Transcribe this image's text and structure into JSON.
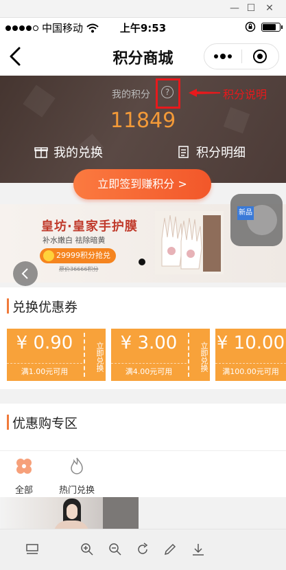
{
  "window": {
    "minimize_icon": "minimize-icon",
    "maximize_icon": "maximize-icon",
    "close_icon": "close-icon"
  },
  "status_bar": {
    "carrier": "中国移动",
    "time": "上午9:53",
    "signal_dots": 5
  },
  "nav": {
    "title": "积分商城"
  },
  "points": {
    "label": "我的积分",
    "value": "11849",
    "annotation": "积分说明",
    "menu": [
      {
        "label": "我的兑换",
        "icon": "gift-icon"
      },
      {
        "label": "积分明细",
        "icon": "receipt-icon"
      }
    ]
  },
  "checkin": {
    "label": "立即签到赚积分 >"
  },
  "banner": {
    "title": "皇坊·皇家手护膜",
    "subtitle": "补水嫩白 祛除暗黄",
    "price": "29999积分抢兑",
    "old_price": "原价36666积分",
    "float_tag": "新品"
  },
  "coupon_section": {
    "title": "兑换优惠券",
    "coupons": [
      {
        "amount": "¥ 0.90",
        "condition": "满1.00元可用",
        "action": "立即兑换"
      },
      {
        "amount": "¥ 3.00",
        "condition": "满4.00元可用",
        "action": "立即兑换"
      },
      {
        "amount": "¥ 10.00",
        "condition": "满100.00元可用",
        "action": ""
      }
    ]
  },
  "deal_section": {
    "title": "优惠购专区"
  },
  "categories": [
    {
      "label": "全部",
      "icon": "clover-icon"
    },
    {
      "label": "热门兑换",
      "icon": "flame-icon"
    }
  ],
  "toolbar": {
    "icons": [
      "layout-icon",
      "zoom-in-icon",
      "zoom-out-icon",
      "rotate-icon",
      "edit-icon",
      "download-icon"
    ]
  },
  "colors": {
    "accent": "#f39a38",
    "annotation_red": "#e8191c",
    "coupon_orange": "#f8a23a"
  }
}
